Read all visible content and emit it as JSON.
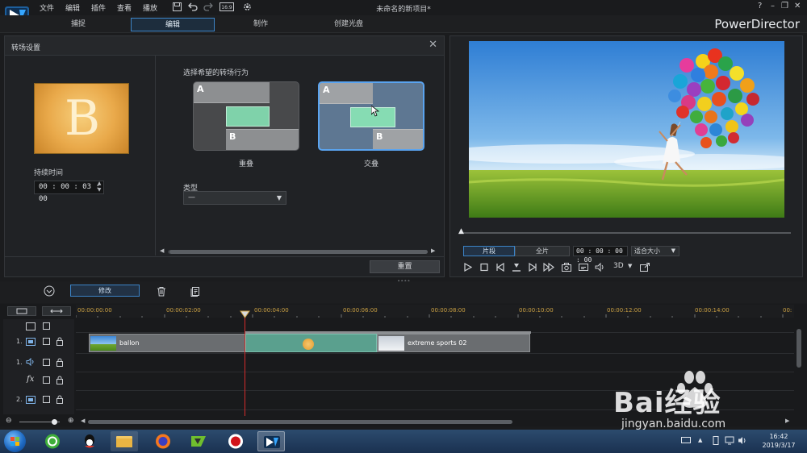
{
  "titlebar": {
    "menu": [
      "文件",
      "编辑",
      "插件",
      "查看",
      "播放"
    ],
    "document_title": "未命名的新项目*",
    "window_controls": [
      "?",
      "–",
      "❐",
      "✕"
    ]
  },
  "modes": {
    "tabs": [
      "捕捉",
      "编辑",
      "制作",
      "创建光盘"
    ],
    "active": "编辑",
    "brand": "PowerDirector"
  },
  "transition_panel": {
    "title": "转场设置",
    "thumbnail_letter": "B",
    "duration_label": "持续时间",
    "duration_value": "00 : 00 : 03 : 00",
    "behavior_label": "选择希望的转场行为",
    "options": [
      {
        "label": "重叠",
        "a": "A",
        "b": "B",
        "selected": false
      },
      {
        "label": "交叠",
        "a": "A",
        "b": "B",
        "selected": true
      }
    ],
    "type_label": "类型",
    "type_value": "—",
    "reset_label": "重置"
  },
  "preview": {
    "seg_clip": "片段",
    "seg_full": "全片",
    "timecode": "00 : 00 : 00 : 00",
    "fit": "适合大小",
    "threed": "3D"
  },
  "timeline_toolbar": {
    "modify_label": "修改"
  },
  "timeline": {
    "ticks": [
      "00:00:00:00",
      "00:00:02:00",
      "00:00:04:00",
      "00:00:06:00",
      "00:00:08:00",
      "00:00:10:00",
      "00:00:12:00",
      "00:00:14:00",
      "00:"
    ],
    "tracks": [
      {
        "num": "1.",
        "kind": "video"
      },
      {
        "num": "1.",
        "kind": "audio"
      },
      {
        "num": "",
        "kind": "fx",
        "label": "fx"
      },
      {
        "num": "2.",
        "kind": "video"
      }
    ],
    "clips": {
      "ballon": "ballon",
      "sports": "extreme sports 02"
    }
  },
  "taskbar": {
    "time": "16:42",
    "date": "2019/3/17"
  },
  "watermark": {
    "brand": "Bai经验",
    "url": "jingyan.baidu.com"
  },
  "colors": {
    "accent": "#3b83c6",
    "transition_green": "#5aa08e",
    "playhead": "#d42a2a",
    "tick_label": "#caa043"
  }
}
